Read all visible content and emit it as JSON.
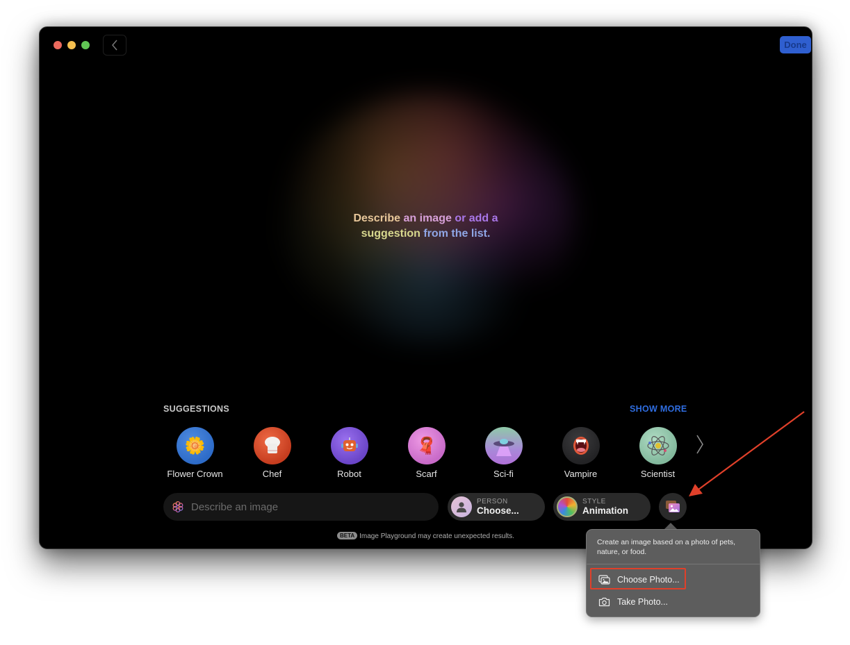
{
  "window": {
    "back_icon": "chevron-left-icon",
    "done_label": "Done"
  },
  "colors": {
    "accent_blue": "#2f6de0",
    "done_bg": "#2f5fd0",
    "annotation_red": "#e0402a"
  },
  "headline": {
    "line1": [
      {
        "text": "Describe ",
        "color": "#e8c79a"
      },
      {
        "text": "an image ",
        "color": "#d7a0d8"
      },
      {
        "text": "or add a",
        "color": "#a977e8"
      }
    ],
    "line2": [
      {
        "text": "suggestion ",
        "color": "#d8d88e"
      },
      {
        "text": "from the list.",
        "color": "#8fa6e6"
      }
    ]
  },
  "suggestions": {
    "heading": "SUGGESTIONS",
    "show_more": "SHOW MORE",
    "items": [
      {
        "label": "Flower Crown",
        "icon": "flower-crown-icon",
        "glyph": "🌼",
        "bg": "#2d6bc8"
      },
      {
        "label": "Chef",
        "icon": "chef-hat-icon",
        "glyph": "👨‍🍳",
        "bg": "#d84a28"
      },
      {
        "label": "Robot",
        "icon": "robot-icon",
        "glyph": "🤖",
        "bg": "#7a52d6"
      },
      {
        "label": "Scarf",
        "icon": "scarf-icon",
        "glyph": "🧣",
        "bg": "#d77ad0"
      },
      {
        "label": "Sci-fi",
        "icon": "ufo-icon",
        "glyph": "🛸",
        "bg": "#9a7ad0"
      },
      {
        "label": "Vampire",
        "icon": "vampire-mouth-icon",
        "glyph": "👄",
        "bg": "#2e2e30"
      },
      {
        "label": "Scientist",
        "icon": "atom-icon",
        "glyph": "⚛",
        "bg": "#8fc4a8"
      }
    ],
    "next_icon": "chevron-right-icon"
  },
  "prompt": {
    "placeholder": "Describe an image",
    "value": "",
    "icon": "image-playground-icon"
  },
  "person": {
    "caption": "PERSON",
    "value": "Choose..."
  },
  "style": {
    "caption": "STYLE",
    "value": "Animation"
  },
  "photo_button": {
    "icon": "photos-icon"
  },
  "disclaimer": {
    "badge": "BETA",
    "text": "Image Playground may create unexpected results."
  },
  "popover": {
    "description": "Create an image based on a photo of pets, nature, or food.",
    "items": [
      {
        "label": "Choose Photo...",
        "icon": "photo-library-icon",
        "highlighted": true
      },
      {
        "label": "Take Photo...",
        "icon": "camera-icon",
        "highlighted": false
      }
    ]
  }
}
